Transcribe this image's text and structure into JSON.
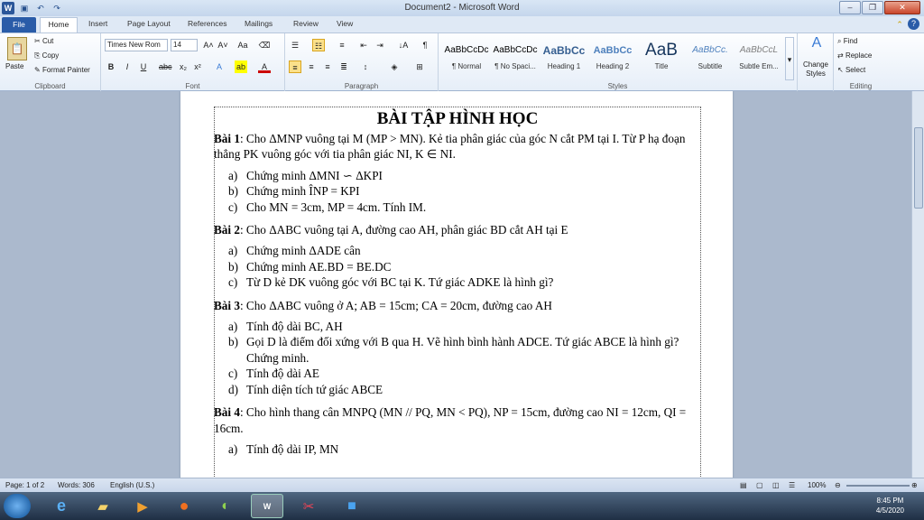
{
  "window": {
    "title": "Document2 - Microsoft Word"
  },
  "tabs": [
    "File",
    "Home",
    "Insert",
    "Page Layout",
    "References",
    "Mailings",
    "Review",
    "View"
  ],
  "clipboard": {
    "paste": "Paste",
    "cut": "Cut",
    "copy": "Copy",
    "format_painter": "Format Painter",
    "label": "Clipboard"
  },
  "font": {
    "name": "Times New Rom",
    "size": "14",
    "label": "Font"
  },
  "paragraph": {
    "label": "Paragraph"
  },
  "styles": {
    "label": "Styles",
    "items": [
      {
        "sample": "AaBbCcDc",
        "name": "¶ Normal"
      },
      {
        "sample": "AaBbCcDc",
        "name": "¶ No Spaci..."
      },
      {
        "sample": "AaBbCc",
        "name": "Heading 1"
      },
      {
        "sample": "AaBbCc",
        "name": "Heading 2"
      },
      {
        "sample": "AaB",
        "name": "Title"
      },
      {
        "sample": "AaBbCc.",
        "name": "Subtitle"
      },
      {
        "sample": "AaBbCcL",
        "name": "Subtle Em..."
      }
    ],
    "change": "Change Styles"
  },
  "editing": {
    "find": "Find",
    "replace": "Replace",
    "select": "Select",
    "label": "Editing"
  },
  "doc": {
    "title": "BÀI TẬP HÌNH HỌC",
    "b1_head": "Bài 1",
    "b1_text": ": Cho ΔMNP  vuông tại M (MP > MN). Kẻ tia phân giác của góc N cắt PM tại I. Từ P hạ đoạn thẳng PK vuông góc với tia phân giác NI, K ∈ NI.",
    "b1_items": [
      {
        "l": "a)",
        "t": "Chứng minh ΔMNI ∽ ΔKPI"
      },
      {
        "l": "b)",
        "t": "Chứng minh ÎNP = KPI"
      },
      {
        "l": "c)",
        "t": "Cho MN = 3cm, MP = 4cm. Tính IM."
      }
    ],
    "b2_head": "Bài 2",
    "b2_text": ": Cho ΔABC  vuông tại A, đường cao AH, phân giác BD cắt AH tại E",
    "b2_items": [
      {
        "l": "a)",
        "t": "Chứng minh ΔADE  cân"
      },
      {
        "l": "b)",
        "t": "Chứng minh AE.BD = BE.DC"
      },
      {
        "l": "c)",
        "t": "Từ D kẻ DK vuông góc với BC tại K. Tứ giác ADKE là hình gì?"
      }
    ],
    "b3_head": "Bài 3",
    "b3_text": ": Cho ΔABC  vuông ở A; AB = 15cm; CA = 20cm, đường cao AH",
    "b3_items": [
      {
        "l": "a)",
        "t": "Tính độ dài BC, AH"
      },
      {
        "l": "b)",
        "t": "Gọi D là điểm đối xứng với B qua H. Vẽ hình bình hành ADCE. Tứ giác ABCE là hình gì? Chứng minh."
      },
      {
        "l": "c)",
        "t": "Tính độ dài AE"
      },
      {
        "l": "d)",
        "t": "Tính diện tích tứ giác ABCE"
      }
    ],
    "b4_head": "Bài 4",
    "b4_text": ": Cho hình thang cân MNPQ (MN // PQ, MN < PQ), NP = 15cm, đường cao  NI = 12cm, QI = 16cm.",
    "b4_items": [
      {
        "l": "a)",
        "t": "Tính độ dài IP, MN"
      }
    ]
  },
  "status": {
    "page": "Page: 1 of 2",
    "words": "Words: 306",
    "lang": "English (U.S.)",
    "zoom": "100%"
  },
  "clock": {
    "time": "8:45 PM",
    "date": "4/5/2020"
  }
}
